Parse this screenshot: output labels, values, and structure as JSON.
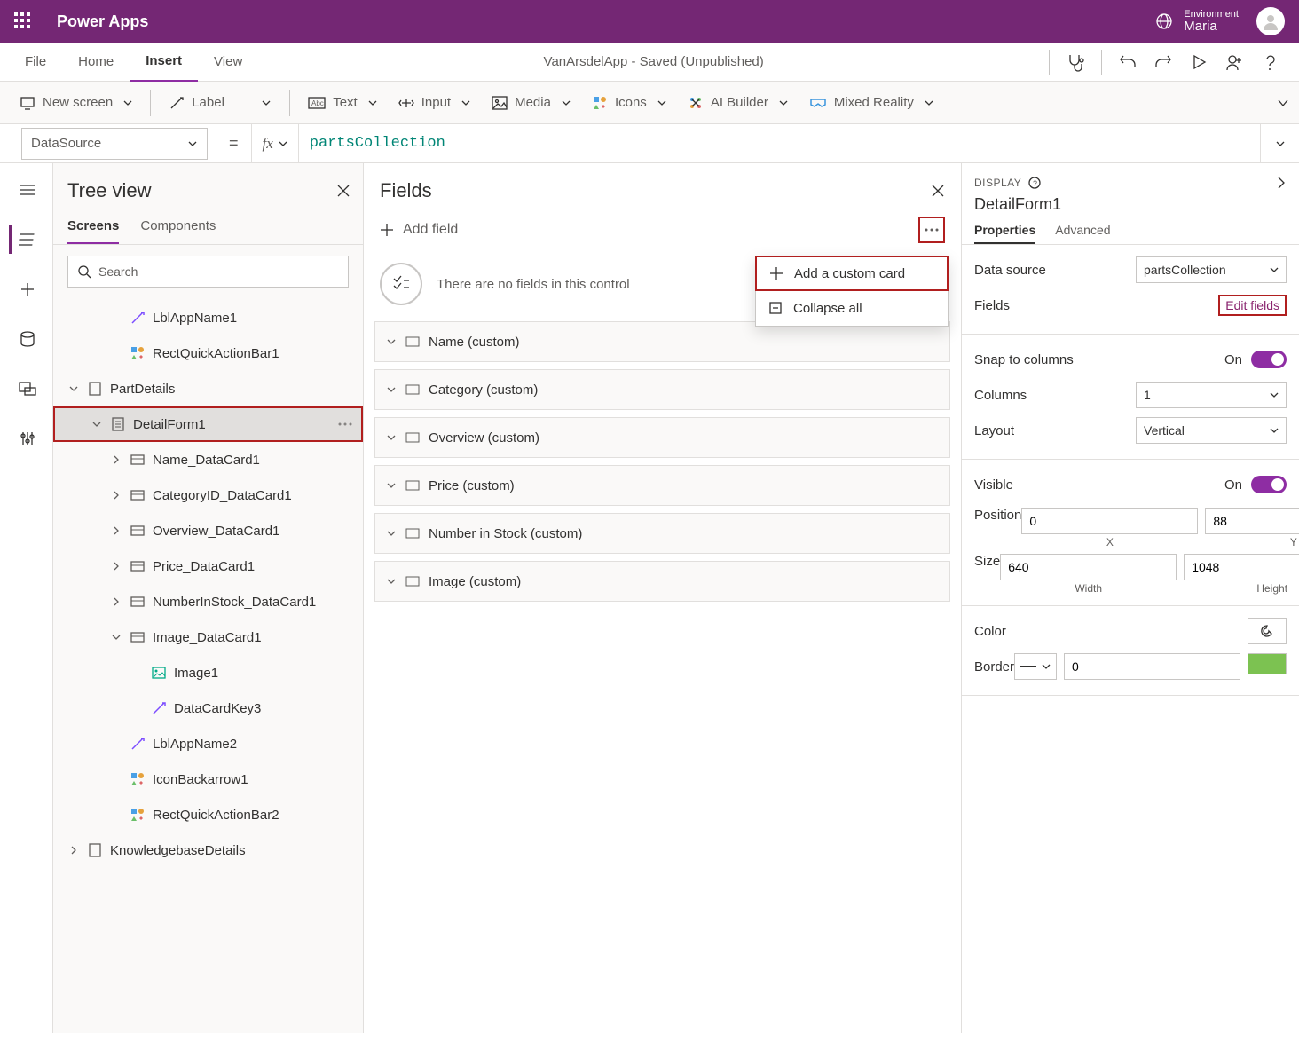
{
  "header": {
    "brand": "Power Apps",
    "env_label": "Environment",
    "env_name": "Maria"
  },
  "menubar": {
    "items": [
      "File",
      "Home",
      "Insert",
      "View"
    ],
    "active": "Insert",
    "doc_status": "VanArsdelApp - Saved (Unpublished)"
  },
  "ribbon": {
    "new_screen": "New screen",
    "label": "Label",
    "text": "Text",
    "input": "Input",
    "media": "Media",
    "icons": "Icons",
    "ai_builder": "AI Builder",
    "mixed_reality": "Mixed Reality"
  },
  "formula": {
    "property": "DataSource",
    "value": "partsCollection"
  },
  "tree": {
    "title": "Tree view",
    "tabs": [
      "Screens",
      "Components"
    ],
    "active_tab": "Screens",
    "search_placeholder": "Search",
    "nodes": [
      {
        "indent": 2,
        "icon": "label",
        "label": "LblAppName1"
      },
      {
        "indent": 2,
        "icon": "group",
        "label": "RectQuickActionBar1"
      },
      {
        "indent": 0,
        "icon": "screen",
        "label": "PartDetails",
        "expander": "open"
      },
      {
        "indent": 1,
        "icon": "form",
        "label": "DetailForm1",
        "expander": "open",
        "selected": true,
        "more": true,
        "highlight": true
      },
      {
        "indent": 2,
        "icon": "card",
        "label": "Name_DataCard1",
        "expander": "closed"
      },
      {
        "indent": 2,
        "icon": "card",
        "label": "CategoryID_DataCard1",
        "expander": "closed"
      },
      {
        "indent": 2,
        "icon": "card",
        "label": "Overview_DataCard1",
        "expander": "closed"
      },
      {
        "indent": 2,
        "icon": "card",
        "label": "Price_DataCard1",
        "expander": "closed"
      },
      {
        "indent": 2,
        "icon": "card",
        "label": "NumberInStock_DataCard1",
        "expander": "closed"
      },
      {
        "indent": 2,
        "icon": "card",
        "label": "Image_DataCard1",
        "expander": "open"
      },
      {
        "indent": 3,
        "icon": "image",
        "label": "Image1"
      },
      {
        "indent": 3,
        "icon": "label",
        "label": "DataCardKey3"
      },
      {
        "indent": 2,
        "icon": "label",
        "label": "LblAppName2"
      },
      {
        "indent": 2,
        "icon": "group",
        "label": "IconBackarrow1"
      },
      {
        "indent": 2,
        "icon": "group",
        "label": "RectQuickActionBar2"
      },
      {
        "indent": 0,
        "icon": "screen",
        "label": "KnowledgebaseDetails",
        "expander": "closed"
      }
    ]
  },
  "fields": {
    "title": "Fields",
    "add_field": "Add field",
    "empty": "There are no fields in this control",
    "items": [
      "Name (custom)",
      "Category (custom)",
      "Overview (custom)",
      "Price (custom)",
      "Number in Stock (custom)",
      "Image (custom)"
    ],
    "popup": {
      "add_custom": "Add a custom card",
      "collapse": "Collapse all"
    }
  },
  "props": {
    "section": "DISPLAY",
    "name": "DetailForm1",
    "tabs": [
      "Properties",
      "Advanced"
    ],
    "active_tab": "Properties",
    "datasource_label": "Data source",
    "datasource_value": "partsCollection",
    "fields_label": "Fields",
    "edit_fields": "Edit fields",
    "snap_label": "Snap to columns",
    "snap_state": "On",
    "columns_label": "Columns",
    "columns_value": "1",
    "layout_label": "Layout",
    "layout_value": "Vertical",
    "visible_label": "Visible",
    "visible_state": "On",
    "position_label": "Position",
    "pos_x": "0",
    "pos_y": "88",
    "x_caption": "X",
    "y_caption": "Y",
    "size_label": "Size",
    "size_w": "640",
    "size_h": "1048",
    "w_caption": "Width",
    "h_caption": "Height",
    "color_label": "Color",
    "border_label": "Border",
    "border_width": "0"
  }
}
